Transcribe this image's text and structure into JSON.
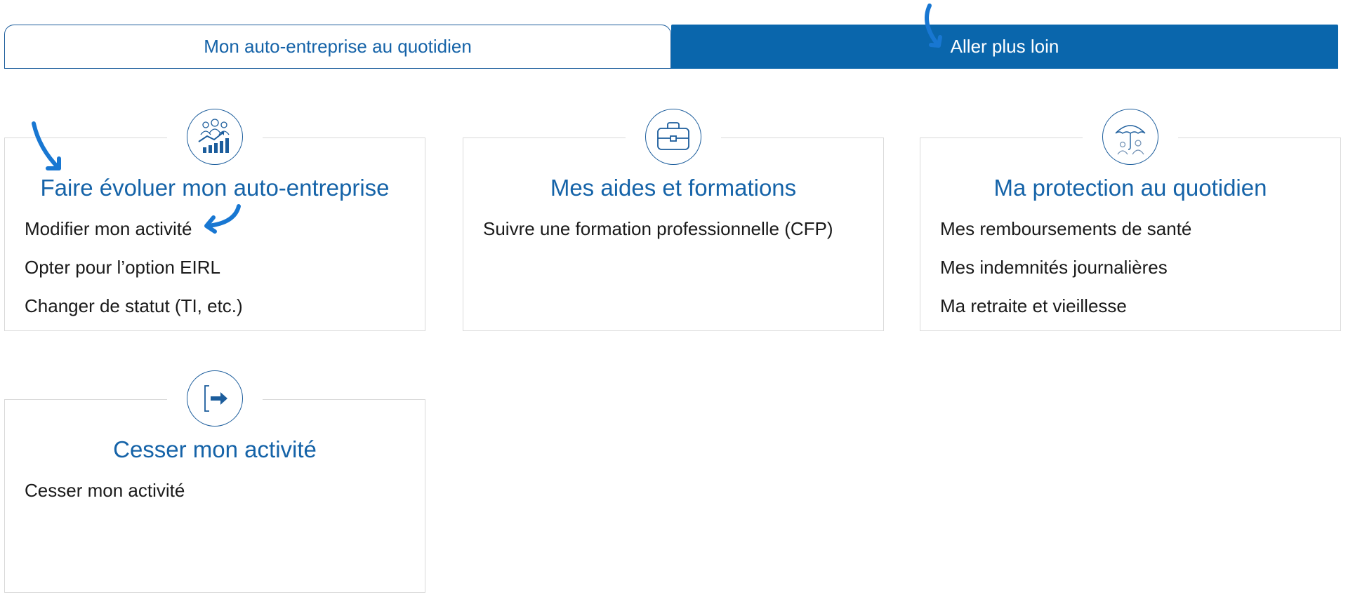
{
  "tabs": [
    {
      "label": "Mon auto-entreprise au quotidien",
      "active": false
    },
    {
      "label": "Aller plus loin",
      "active": true
    }
  ],
  "cards": [
    {
      "icon": "growth-chart-icon",
      "title": "Faire évoluer mon auto-entreprise",
      "links": [
        "Modifier mon activité",
        "Opter pour l’option EIRL",
        "Changer de statut (TI, etc.)"
      ]
    },
    {
      "icon": "briefcase-icon",
      "title": "Mes aides et formations",
      "links": [
        "Suivre une formation professionnelle (CFP)"
      ]
    },
    {
      "icon": "umbrella-family-icon",
      "title": "Ma protection au quotidien",
      "links": [
        "Mes remboursements de santé",
        "Mes indemnités journalières",
        "Ma retraite et vieillesse"
      ]
    },
    {
      "icon": "exit-arrow-icon",
      "title": "Cesser mon activité",
      "links": [
        "Cesser mon activité"
      ]
    }
  ],
  "colors": {
    "accent": "#0a66ac",
    "title": "#1563a8",
    "annotation_arrow": "#1877d2",
    "card_border": "#dadada"
  }
}
